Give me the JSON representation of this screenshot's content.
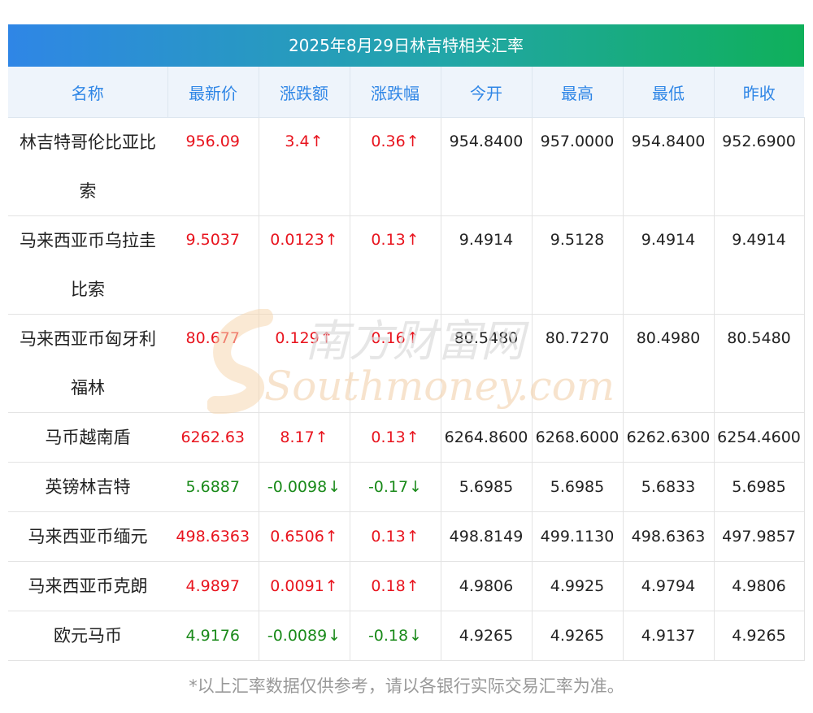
{
  "title": "2025年8月29日林吉特相关汇率",
  "headers": [
    "名称",
    "最新价",
    "涨跌额",
    "涨跌幅",
    "今开",
    "最高",
    "最低",
    "昨收"
  ],
  "rows": [
    {
      "name": "林吉特哥伦比亚比索",
      "latest": "956.09",
      "change": "3.4",
      "pct": "0.36",
      "dir": "up",
      "open": "954.8400",
      "high": "957.0000",
      "low": "954.8400",
      "prev": "952.6900"
    },
    {
      "name": "马来西亚币乌拉圭比索",
      "latest": "9.5037",
      "change": "0.0123",
      "pct": "0.13",
      "dir": "up",
      "open": "9.4914",
      "high": "9.5128",
      "low": "9.4914",
      "prev": "9.4914"
    },
    {
      "name": "马来西亚币匈牙利福林",
      "latest": "80.677",
      "change": "0.129",
      "pct": "0.16",
      "dir": "up",
      "open": "80.5480",
      "high": "80.7270",
      "low": "80.4980",
      "prev": "80.5480"
    },
    {
      "name": "马币越南盾",
      "latest": "6262.63",
      "change": "8.17",
      "pct": "0.13",
      "dir": "up",
      "open": "6264.8600",
      "high": "6268.6000",
      "low": "6262.6300",
      "prev": "6254.4600"
    },
    {
      "name": "英镑林吉特",
      "latest": "5.6887",
      "change": "-0.0098",
      "pct": "-0.17",
      "dir": "down",
      "open": "5.6985",
      "high": "5.6985",
      "low": "5.6833",
      "prev": "5.6985"
    },
    {
      "name": "马来西亚币缅元",
      "latest": "498.6363",
      "change": "0.6506",
      "pct": "0.13",
      "dir": "up",
      "open": "498.8149",
      "high": "499.1130",
      "low": "498.6363",
      "prev": "497.9857"
    },
    {
      "name": "马来西亚币克朗",
      "latest": "4.9897",
      "change": "0.0091",
      "pct": "0.18",
      "dir": "up",
      "open": "4.9806",
      "high": "4.9925",
      "low": "4.9794",
      "prev": "4.9806"
    },
    {
      "name": "欧元马币",
      "latest": "4.9176",
      "change": "-0.0089",
      "pct": "-0.18",
      "dir": "down",
      "open": "4.9265",
      "high": "4.9265",
      "low": "4.9137",
      "prev": "4.9265"
    }
  ],
  "arrows": {
    "up": "↑",
    "down": "↓"
  },
  "watermark": {
    "cn": "南方财富网",
    "en": "Southmoney.com"
  },
  "note": "*以上汇率数据仅供参考，请以各银行实际交易汇率为准。",
  "colors": {
    "up": "#e8141e",
    "down": "#1a8a1a",
    "header_text": "#2f86e6",
    "title_gradient_start": "#2f86e6",
    "title_gradient_end": "#0fb05a"
  }
}
